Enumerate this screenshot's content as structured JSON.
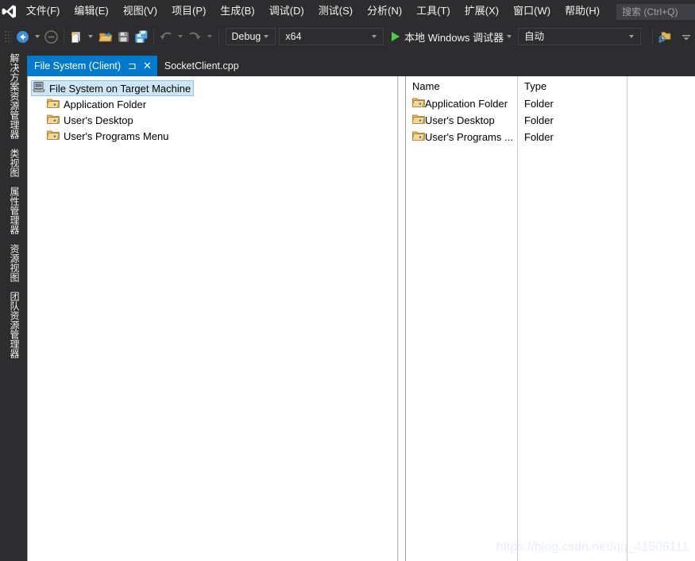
{
  "app": {
    "logo_icon": "visual-studio-logo"
  },
  "menubar": {
    "items": [
      {
        "label": "文件(F)",
        "accel": "F"
      },
      {
        "label": "编辑(E)",
        "accel": "E"
      },
      {
        "label": "视图(V)",
        "accel": "V"
      },
      {
        "label": "项目(P)",
        "accel": "P"
      },
      {
        "label": "生成(B)",
        "accel": "B"
      },
      {
        "label": "调试(D)",
        "accel": "D"
      },
      {
        "label": "测试(S)",
        "accel": "S"
      },
      {
        "label": "分析(N)",
        "accel": "N"
      },
      {
        "label": "工具(T)",
        "accel": "T"
      },
      {
        "label": "扩展(X)",
        "accel": "X"
      },
      {
        "label": "窗口(W)",
        "accel": "W"
      },
      {
        "label": "帮助(H)",
        "accel": "H"
      }
    ],
    "search": {
      "placeholder": "搜索 (Ctrl+Q)",
      "value": ""
    }
  },
  "toolbar": {
    "back_icon": "navigate-back-icon",
    "forward_icon": "navigate-forward-icon",
    "new_item_icon": "new-item-icon",
    "open_file_icon": "open-file-icon",
    "save_icon": "save-icon",
    "save_all_icon": "save-all-icon",
    "undo_icon": "undo-icon",
    "redo_icon": "redo-icon",
    "configuration": "Debug",
    "platform": "x64",
    "run_label": "本地 Windows 调试器",
    "run_icon": "play-icon",
    "auto_label": "自动",
    "find_in_files_icon": "find-in-folder-icon",
    "overflow_icon": "toolbar-overflow-icon"
  },
  "sidebar": {
    "tabs": [
      {
        "label": "解决方案资源管理器"
      },
      {
        "label": "类视图"
      },
      {
        "label": "属性管理器"
      },
      {
        "label": "资源视图"
      },
      {
        "label": "团队资源管理器"
      }
    ]
  },
  "tabs": [
    {
      "label": "File System (Client)",
      "active": true,
      "pin_icon": "pin-icon",
      "close_icon": "close-icon"
    },
    {
      "label": "SocketClient.cpp",
      "active": false
    }
  ],
  "designer": {
    "tree": {
      "root": {
        "label": "File System on Target Machine",
        "icon": "target-machine-icon",
        "selected": true
      },
      "children": [
        {
          "label": "Application Folder",
          "icon": "folder-icon"
        },
        {
          "label": "User's Desktop",
          "icon": "folder-icon"
        },
        {
          "label": "User's Programs Menu",
          "icon": "folder-icon"
        }
      ]
    },
    "list": {
      "columns": [
        "Name",
        "Type"
      ],
      "rows": [
        {
          "name": "Application Folder",
          "type": "Folder",
          "icon": "folder-icon"
        },
        {
          "name": "User's Desktop",
          "type": "Folder",
          "icon": "folder-icon"
        },
        {
          "name": "User's Programs ...",
          "type": "Folder",
          "icon": "folder-icon"
        }
      ]
    }
  },
  "watermark": {
    "text": "https://blog.csdn.net/qq_41506111"
  },
  "colors": {
    "chrome": "#2d2d30",
    "accent": "#007acc",
    "surface": "#ffffff",
    "selection": "#cde6f7",
    "play_green": "#4ec94e",
    "folder_yellow": "#e3b64f"
  }
}
